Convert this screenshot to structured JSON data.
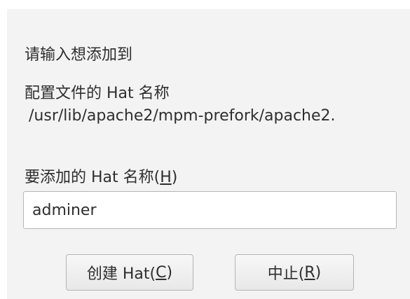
{
  "dialog": {
    "prompt_line1": "请输入想添加到",
    "prompt_line2": "配置文件的 Hat 名称",
    "profile_path": "/usr/lib/apache2/mpm-prefork/apache2.",
    "field_label_text": "要添加的 Hat 名称(",
    "field_label_mnemonic": "H",
    "field_label_close": ")",
    "hat_name_value": "adminer"
  },
  "buttons": {
    "create_text": "创建 Hat(",
    "create_mnemonic": "C",
    "create_close": ")",
    "abort_text": "中止(",
    "abort_mnemonic": "R",
    "abort_close": ")"
  }
}
